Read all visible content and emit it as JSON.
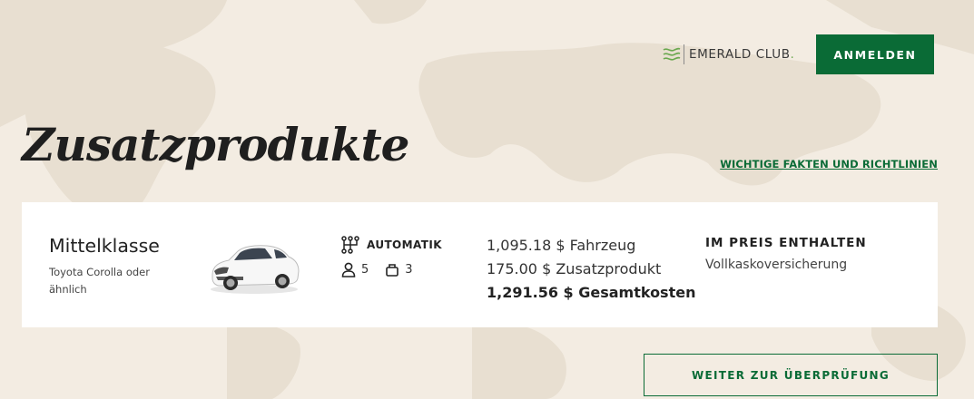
{
  "header": {
    "club_name": "EMERALD CLUB",
    "club_dot": ".",
    "signin_label": "ANMELDEN"
  },
  "page": {
    "title": "Zusatzprodukte",
    "facts_link": "WICHTIGE FAKTEN UND RICHTLINIEN"
  },
  "vehicle": {
    "class_name": "Mittelklasse",
    "model": "Toyota Corolla oder ähnlich",
    "transmission": "AUTOMATIK",
    "passengers": "5",
    "bags": "3",
    "image_icon": "white-sedan-car"
  },
  "pricing": {
    "vehicle_line": "1,095.18 $ Fahrzeug",
    "addon_line": "175.00 $ Zusatzprodukt",
    "total_line": "1,291.56 $ Gesamtkosten"
  },
  "included": {
    "heading": "IM PREIS ENTHALTEN",
    "item": "Vollkaskoversicherung"
  },
  "actions": {
    "continue_label": "WEITER ZUR ÜBERPRÜFUNG"
  },
  "colors": {
    "brand_green": "#0a6b36",
    "background": "#f3ece2",
    "map_tint": "#e9e0d2"
  }
}
